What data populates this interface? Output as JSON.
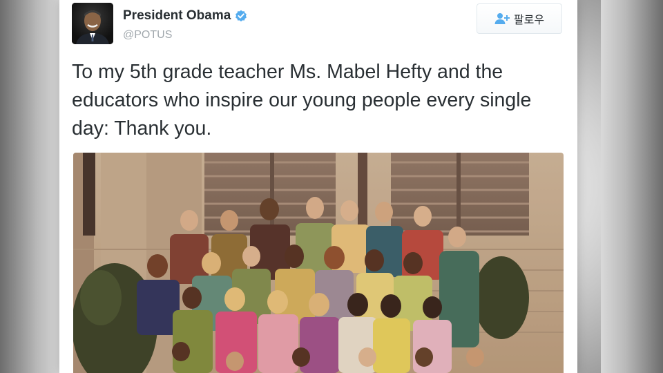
{
  "tweet": {
    "display_name": "President Obama",
    "handle": "@POTUS",
    "text": "To my 5th grade teacher Ms. Mabel Hefty and the educators who inspire our young people every single day: Thank you.",
    "verified": true
  },
  "follow_button": {
    "label": "팔로우",
    "icon": "add-user-icon"
  },
  "colors": {
    "text": "#292f33",
    "handle": "#a1a8ad",
    "verified_badge": "#55acee",
    "follow_icon": "#55acee"
  }
}
